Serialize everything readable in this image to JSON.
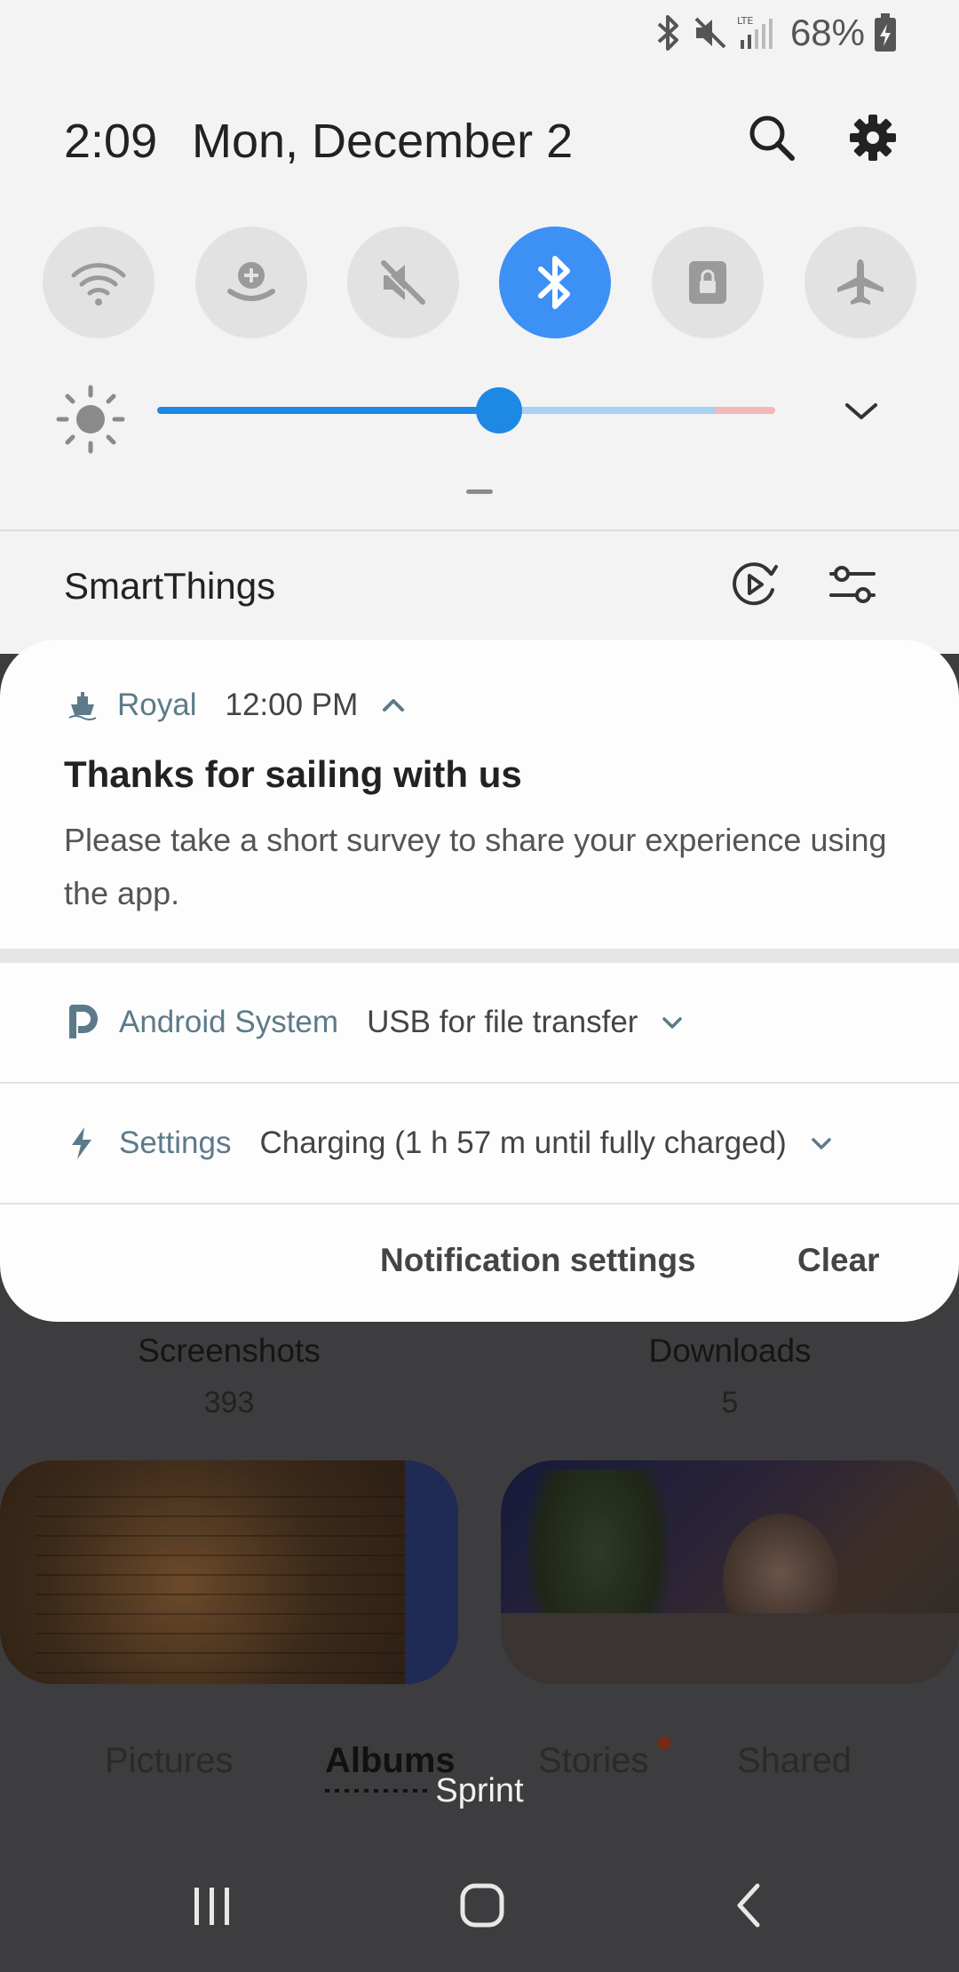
{
  "status_bar": {
    "battery_percent": "68%",
    "icons": [
      "bluetooth-icon",
      "mute-icon",
      "lte-signal-icon",
      "battery-charging-icon"
    ]
  },
  "header": {
    "time": "2:09",
    "date": "Mon, December 2",
    "search_icon": "search-icon",
    "settings_icon": "gear-icon"
  },
  "quick_settings": {
    "tiles": [
      {
        "icon": "wifi-icon",
        "active": false
      },
      {
        "icon": "mobile-hotspot-icon",
        "active": false
      },
      {
        "icon": "sound-mute-icon",
        "active": false
      },
      {
        "icon": "bluetooth-icon",
        "active": true
      },
      {
        "icon": "rotation-lock-icon",
        "active": false
      },
      {
        "icon": "airplane-icon",
        "active": false
      }
    ],
    "brightness_level": 0.55,
    "colors": {
      "accent": "#3d91f5",
      "slider": "#1e88e5",
      "slider_remaining": "#a8d0f5",
      "slider_end": "#f5b8b8"
    }
  },
  "smartthings": {
    "label": "SmartThings"
  },
  "notifications": {
    "royal": {
      "app": "Royal",
      "time": "12:00 PM",
      "title": "Thanks for sailing with us",
      "body": "Please take a short survey to share your experience using the app."
    },
    "android": {
      "app": "Android System",
      "text": "USB for file transfer"
    },
    "settings": {
      "app": "Settings",
      "text": "Charging (1 h 57 m until fully charged)"
    },
    "actions": {
      "notification_settings": "Notification settings",
      "clear": "Clear"
    }
  },
  "background_app": {
    "albums": [
      {
        "name": "Screenshots",
        "count": "393"
      },
      {
        "name": "Downloads",
        "count": "5"
      }
    ],
    "tabs": [
      "Pictures",
      "Albums",
      "Stories",
      "Shared"
    ],
    "carrier": "Sprint"
  }
}
